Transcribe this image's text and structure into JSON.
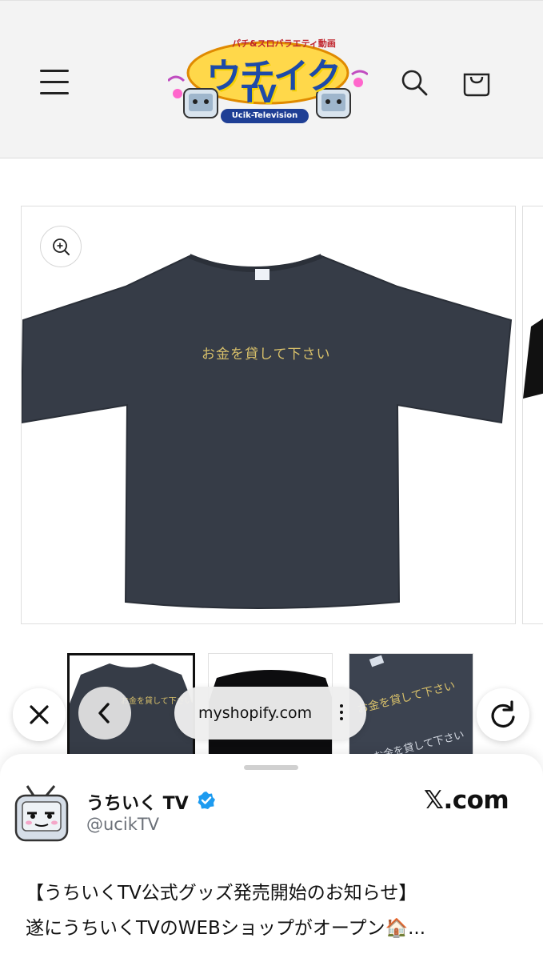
{
  "header": {
    "logo_tagline": "パチ&スロバラエティ動画",
    "logo_mark": "ウチイク",
    "logo_tv": "TV",
    "logo_sub": "Ucik-Television"
  },
  "product": {
    "shirt_print": "お金を貸して下さい",
    "thumbnail_print": "お金を貸して下さい"
  },
  "browser": {
    "url": "myshopify.com"
  },
  "sheet": {
    "account_name": "うちいく TV",
    "account_handle": "@ucikTV",
    "source": "𝕏.com",
    "line1": "【うちいくTV公式グッズ発売開始のお知らせ】",
    "line2": "遂にうちいくTVのWEBショップがオープン🏠..."
  },
  "colors": {
    "shirt": "#363c47",
    "print": "#d8c06a",
    "verified": "#1d9bf0"
  }
}
